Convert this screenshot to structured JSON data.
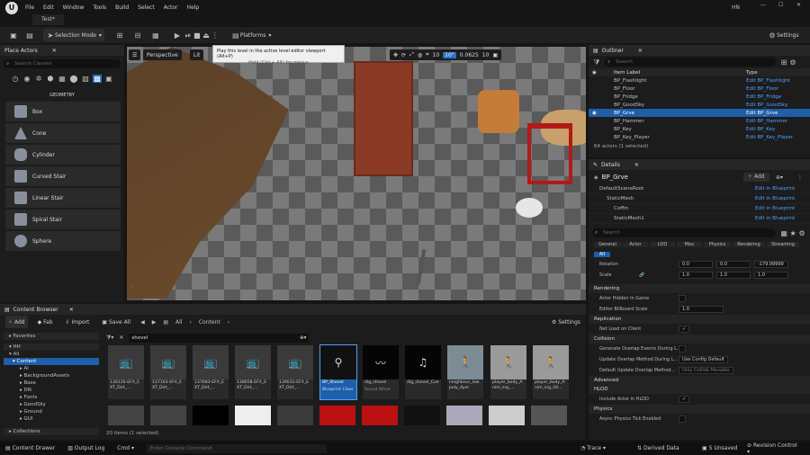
{
  "app": {
    "project_tab": "Test*",
    "user": "HN"
  },
  "menu": [
    "File",
    "Edit",
    "Window",
    "Tools",
    "Build",
    "Select",
    "Actor",
    "Help"
  ],
  "toolbar": {
    "selection_mode": "Selection Mode",
    "platforms": "Platforms",
    "settings": "Settings"
  },
  "tooltip": {
    "title": "Play this level in the active level editor viewport (Alt+P)",
    "sub": "Hold (Ctrl + Alt) for menus"
  },
  "place_actors": {
    "title": "Place Actors",
    "search_placeholder": "Search Classes",
    "category": "GEOMETRY",
    "items": [
      "Box",
      "Cone",
      "Cylinder",
      "Curved Stair",
      "Linear Stair",
      "Spiral Stair",
      "Sphere"
    ]
  },
  "viewport": {
    "perspective": "Perspective",
    "lit": "Lit",
    "angle": "10°",
    "fov": "0.0625",
    "snap": "10",
    "grid": "10"
  },
  "outliner": {
    "title": "Outliner",
    "search_placeholder": "Search",
    "col_label": "Item Label",
    "col_type": "Type",
    "rows": [
      {
        "label": "BP_Flashlight",
        "type": "Edit BP_Flashlight"
      },
      {
        "label": "BP_Floor",
        "type": "Edit BP_Floor"
      },
      {
        "label": "BP_Fridge",
        "type": "Edit BP_Fridge"
      },
      {
        "label": "BP_GoodSky",
        "type": "Edit BP_GoodSky"
      },
      {
        "label": "BP_Grve",
        "type": "Edit BP_Grve"
      },
      {
        "label": "BP_Hammer",
        "type": "Edit BP_Hammer"
      },
      {
        "label": "BP_Key",
        "type": "Edit BP_Key"
      },
      {
        "label": "BP_Key_Player",
        "type": "Edit BP_Key_Player"
      }
    ],
    "count": "64 actors (1 selected)"
  },
  "details": {
    "title": "Details",
    "object": "BP_Grve",
    "add": "Add",
    "components": [
      {
        "name": "DefaultSceneRoot",
        "link": "Edit in Blueprint"
      },
      {
        "name": "StaticMesh",
        "link": "Edit in Blueprint"
      },
      {
        "name": "Coffin",
        "link": "Edit in Blueprint"
      },
      {
        "name": "StaticMesh1",
        "link": "Edit in Blueprint"
      }
    ],
    "search_placeholder": "Search",
    "tabs": [
      "General",
      "Actor",
      "LOD",
      "Misc",
      "Physics",
      "Rendering",
      "Streaming"
    ],
    "all": "All",
    "rotation": {
      "label": "Rotation",
      "x": "0.0",
      "y": "0.0",
      "z": "-179.99999"
    },
    "scale": {
      "label": "Scale",
      "x": "1.0",
      "y": "1.0",
      "z": "1.0"
    },
    "sections": {
      "rendering": "Rendering",
      "replication": "Replication",
      "collision": "Collision",
      "advanced": "Advanced",
      "hlod": "HLOD",
      "physics": "Physics"
    },
    "props": {
      "hidden": "Actor Hidden In Game",
      "billboard": "Editor Billboard Scale",
      "billboard_val": "1.0",
      "net_load": "Net Load on Client",
      "overlap": "Generate Overlap Events During L...",
      "update_overlap": "Update Overlap Method During L...",
      "update_overlap_val": "Use Config Default",
      "default_overlap": "Default Update Overlap Method...",
      "default_overlap_val": "Only Collide Movable",
      "hlod_include": "Include Actor in HLOD",
      "async": "Async Physics Tick Enabled"
    }
  },
  "content_browser": {
    "title": "Content Browser",
    "add": "Add",
    "fab": "Fab",
    "import": "Import",
    "save_all": "Save All",
    "breadcrumb": [
      "All",
      "Content"
    ],
    "settings": "Settings",
    "filter_text": "shovel",
    "favorites": "Favorites",
    "project": "HH",
    "folders": [
      "All",
      "Content",
      "AI",
      "BackgroundAssets",
      "Base",
      "DN",
      "Fonts",
      "GoodSky",
      "Ground",
      "GUI"
    ],
    "collections": "Collections",
    "tiles": [
      {
        "name": "136126-EFX_EXT_Dirt_..."
      },
      {
        "name": "137163-EFX_EXT_Dirt_..."
      },
      {
        "name": "137683-EFX_EXT_Dirt_..."
      },
      {
        "name": "138658-EFX_EXT_Dirt_..."
      },
      {
        "name": "139031-EFX_EXT_Dirt_..."
      },
      {
        "name": "BP_Shovel",
        "sub": "Blueprint Class"
      },
      {
        "name": "dig_shovel",
        "sub": "Sound Wave"
      },
      {
        "name": "dig_shovel_Cue",
        "sub": ""
      },
      {
        "name": "",
        "sub": ""
      },
      {
        "name": "neighbour_lowpoly_Ayer",
        "sub": ""
      },
      {
        "name": "player_body_Anim_ing_...",
        "sub": ""
      },
      {
        "name": "player_body_Anim_ing_Idl...",
        "sub": ""
      }
    ],
    "count": "20 items (1 selected)"
  },
  "status": {
    "content_drawer": "Content Drawer",
    "output_log": "Output Log",
    "cmd": "Cmd",
    "console_placeholder": "Enter Console Command",
    "trace": "Trace",
    "derived": "Derived Data",
    "unsaved": "5 Unsaved",
    "revision": "Revision Control"
  },
  "colors": {
    "accent": "#1f5ea8",
    "link": "#4ea1ff"
  }
}
